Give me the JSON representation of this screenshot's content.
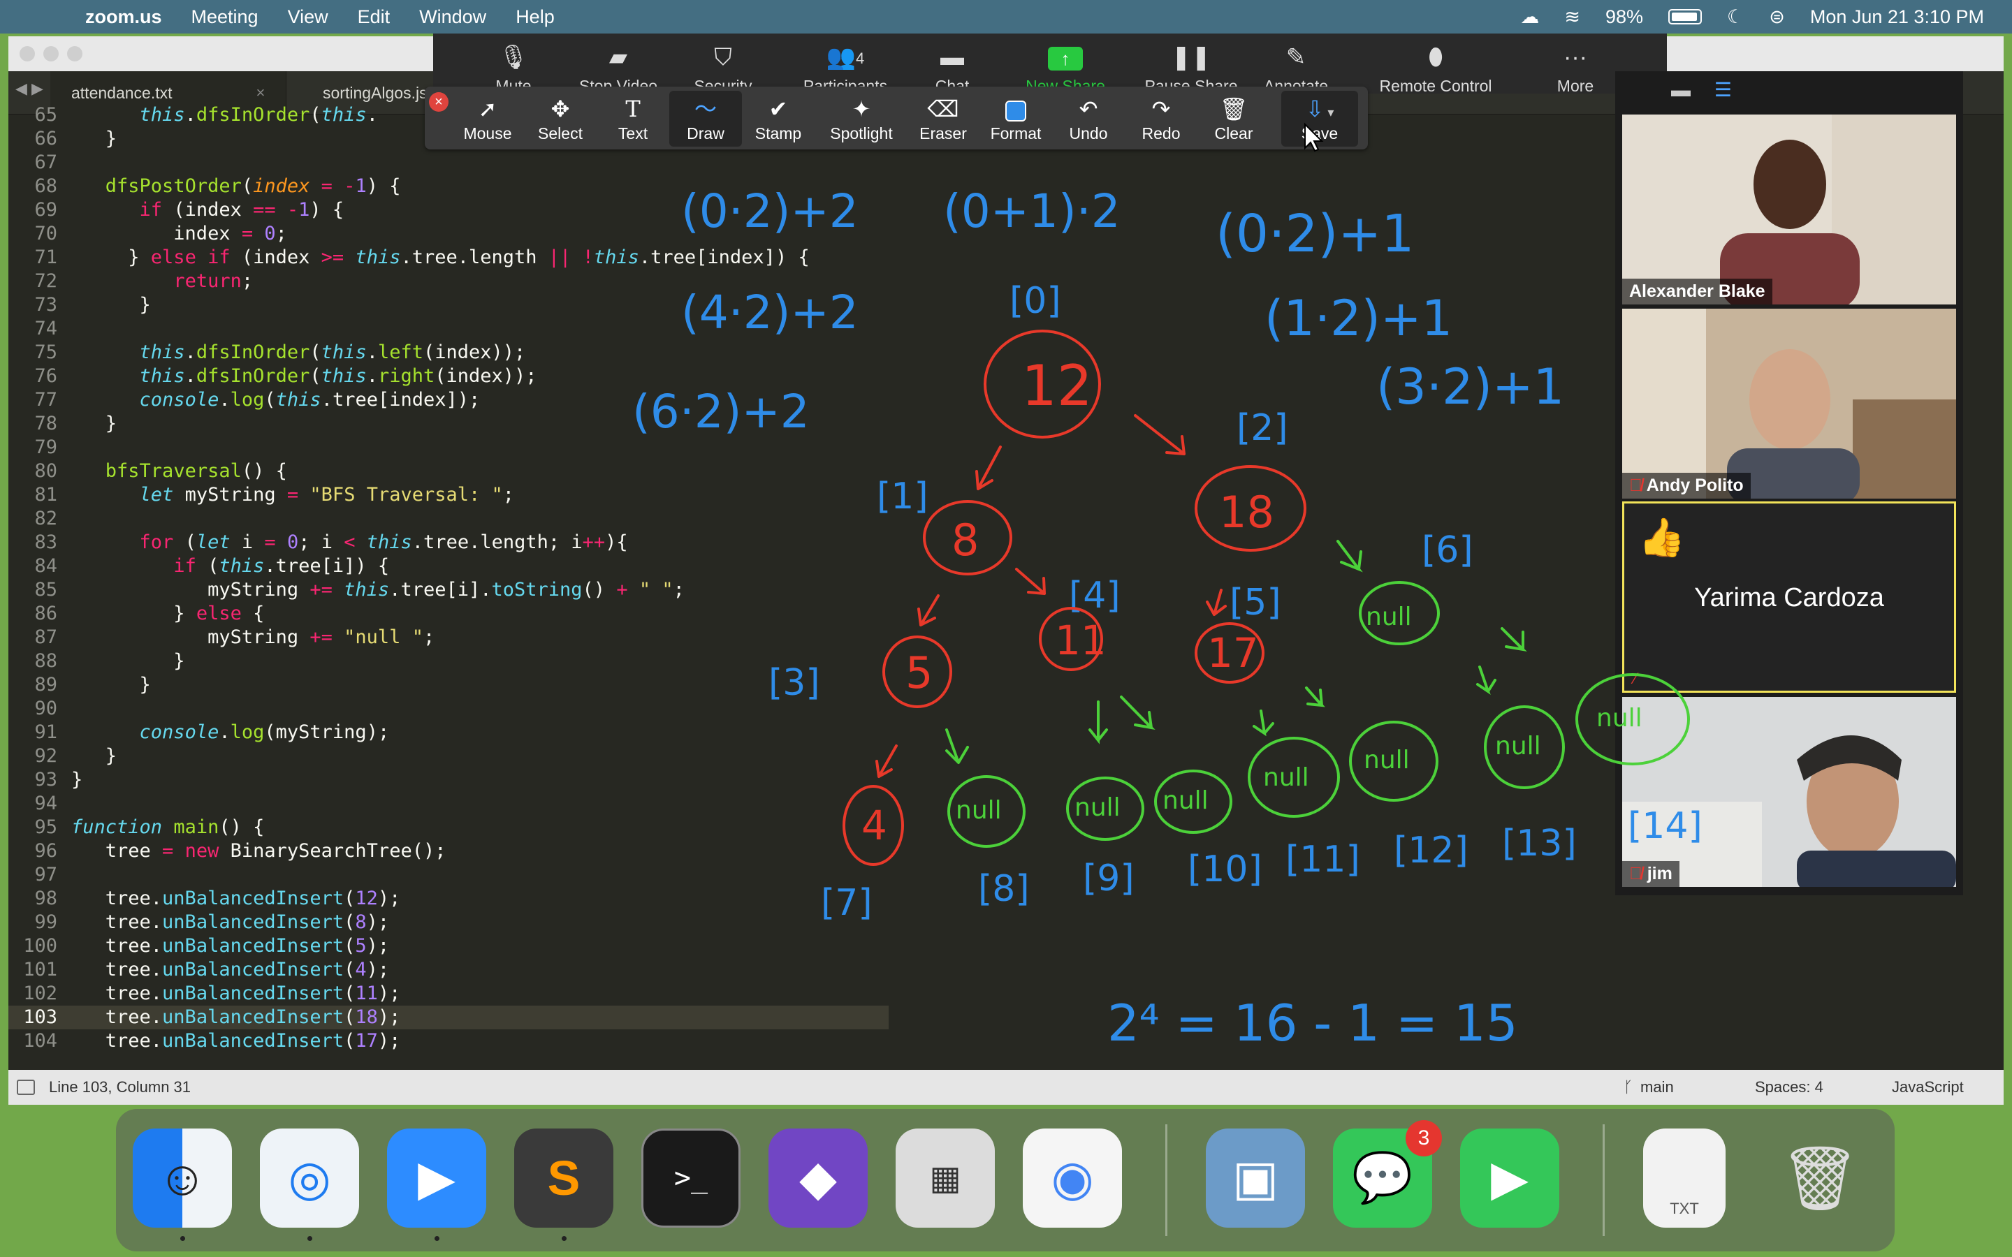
{
  "menubar": {
    "app": "zoom.us",
    "items": [
      "Meeting",
      "View",
      "Edit",
      "Window",
      "Help"
    ],
    "battery": "98%",
    "datetime": "Mon Jun 21  3:10 PM"
  },
  "editor": {
    "tabs": [
      "attendance.txt",
      "sortingAlgos.js"
    ],
    "status_position": "Line 103, Column 31",
    "status_branch": "main",
    "status_spaces": "Spaces: 4",
    "status_language": "JavaScript"
  },
  "zoom_toolbar": {
    "buttons": [
      "Mute",
      "Stop Video",
      "Security",
      "Participants",
      "Chat",
      "New Share",
      "Pause Share",
      "Annotate",
      "Remote Control",
      "More"
    ],
    "participants_count": "4"
  },
  "annotation_toolbar": {
    "buttons": [
      "Mouse",
      "Select",
      "Text",
      "Draw",
      "Stamp",
      "Spotlight",
      "Eraser",
      "Format",
      "Undo",
      "Redo",
      "Clear",
      "Save"
    ]
  },
  "participants": [
    {
      "name": "Alexander Blake"
    },
    {
      "name": "Andy Polito"
    },
    {
      "name": "Yarima Cardoza"
    },
    {
      "name": "jim"
    }
  ],
  "whiteboard": {
    "formulas": [
      "(0·2)+2",
      "(0+1)·2",
      "(4·2)+2",
      "(6·2)+2",
      "(0·2)+1",
      "(1·2)+1",
      "(3·2)+1",
      "2⁴ = 16 - 1 = 15"
    ],
    "indices": [
      "[0]",
      "[1]",
      "[2]",
      "[3]",
      "[4]",
      "[5]",
      "[6]",
      "[7]",
      "[8]",
      "[9]",
      "[10]",
      "[11]",
      "[12]",
      "[13]",
      "[14]"
    ],
    "nodes": [
      "12",
      "8",
      "18",
      "5",
      "11",
      "17",
      "4"
    ],
    "null_label": "null"
  },
  "dock": {
    "messages_badge": "3",
    "txt_label": "TXT"
  },
  "colors": {
    "annotation_blue": "#2f8ce8",
    "annotation_red": "#e8392a",
    "annotation_green": "#4cd13a",
    "share_green": "#28c940"
  }
}
